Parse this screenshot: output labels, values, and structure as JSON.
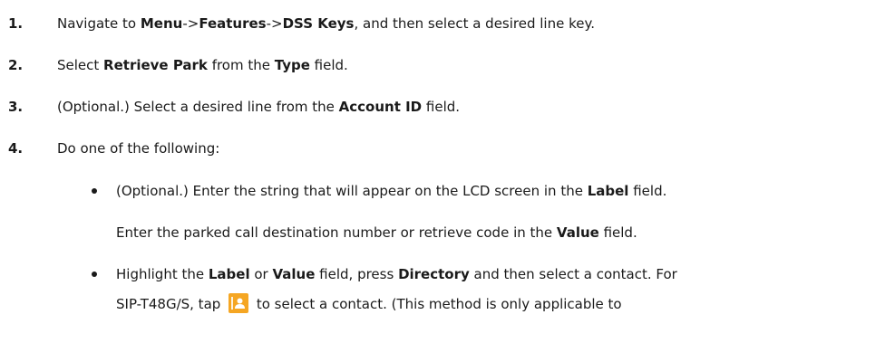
{
  "steps": [
    {
      "number": "1.",
      "parts": [
        "Navigate to ",
        "Menu",
        "->",
        "Features",
        "->",
        "DSS Keys",
        ", and then select a desired line key."
      ]
    },
    {
      "number": "2.",
      "parts": [
        "Select ",
        "Retrieve Park",
        " from the ",
        "Type",
        " field."
      ]
    },
    {
      "number": "3.",
      "parts": [
        "(Optional.) Select a desired line from the ",
        "Account ID",
        " field."
      ]
    },
    {
      "number": "4.",
      "parts": [
        "Do one of the following:"
      ]
    }
  ],
  "options": {
    "first": {
      "line1": [
        "(Optional.) Enter the string that will appear on the LCD screen in the ",
        "Label",
        " field."
      ],
      "line2": [
        "Enter the parked call destination number or retrieve code in the ",
        "Value",
        " field."
      ]
    },
    "second": {
      "line1": [
        "Highlight the ",
        "Label",
        " or ",
        "Value",
        " field, press ",
        "Directory",
        " and then select a contact. For"
      ],
      "line2_before_icon": "SIP-T48G/S, tap",
      "line2_after_icon": "to select a contact. (This method is only applicable to",
      "icon": "directory-contact-icon"
    }
  },
  "colors": {
    "text": "#1a1a1a",
    "icon_bg": "#f5a623"
  }
}
